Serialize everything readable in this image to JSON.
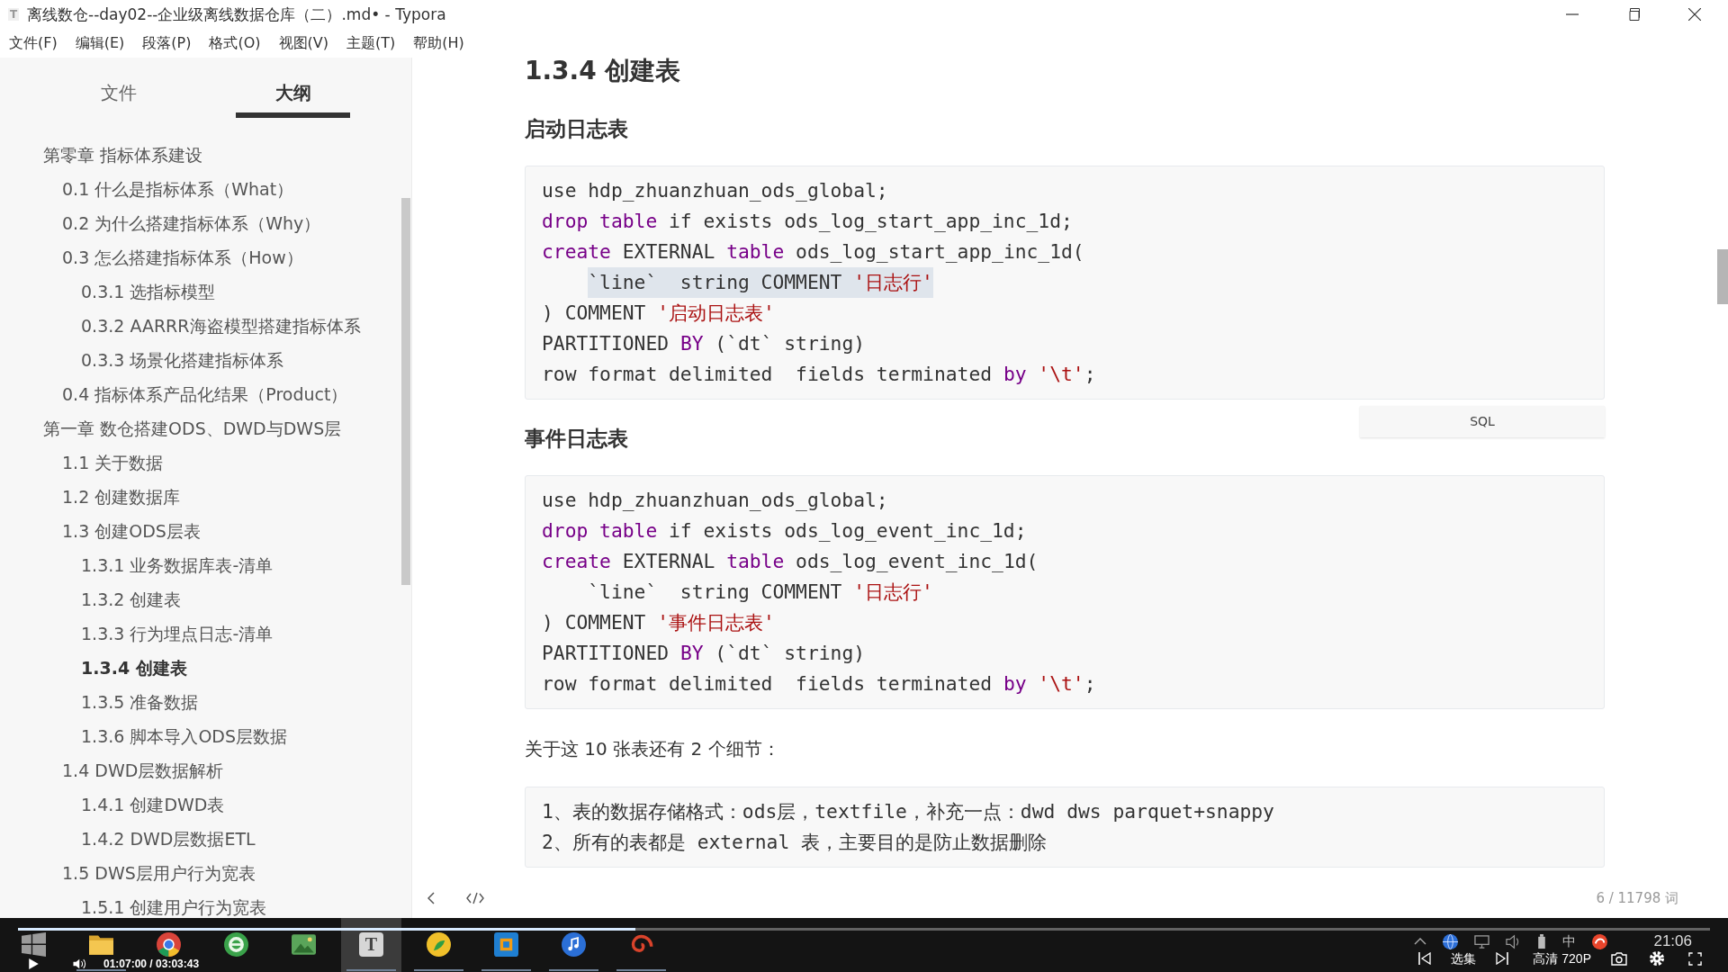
{
  "window": {
    "icon_letter": "T",
    "title": "离线数仓--day02--企业级离线数据仓库（二）.md• - Typora",
    "maximized": true
  },
  "menu": [
    "文件(F)",
    "编辑(E)",
    "段落(P)",
    "格式(O)",
    "视图(V)",
    "主题(T)",
    "帮助(H)"
  ],
  "sidebar": {
    "tabs": [
      {
        "label": "文件",
        "selected": false
      },
      {
        "label": "大纲",
        "selected": true
      }
    ],
    "outline": [
      {
        "label": "第零章 指标体系建设",
        "selected": false,
        "children": [
          {
            "label": "0.1 什么是指标体系（What）",
            "selected": false
          },
          {
            "label": "0.2 为什么搭建指标体系（Why）",
            "selected": false
          },
          {
            "label": "0.3 怎么搭建指标体系（How）",
            "selected": false,
            "children": [
              {
                "label": "0.3.1 选指标模型",
                "selected": false
              },
              {
                "label": "0.3.2 AARRR海盗模型搭建指标体系",
                "selected": false
              },
              {
                "label": "0.3.3 场景化搭建指标体系",
                "selected": false
              }
            ]
          },
          {
            "label": "0.4 指标体系产品化结果（Product）",
            "selected": false
          }
        ]
      },
      {
        "label": "第一章 数仓搭建ODS、DWD与DWS层",
        "selected": false,
        "children": [
          {
            "label": "1.1 关于数据",
            "selected": false
          },
          {
            "label": "1.2 创建数据库",
            "selected": false
          },
          {
            "label": "1.3 创建ODS层表",
            "selected": false,
            "children": [
              {
                "label": "1.3.1 业务数据库表-清单",
                "selected": false
              },
              {
                "label": "1.3.2 创建表",
                "selected": false
              },
              {
                "label": "1.3.3 行为埋点日志-清单",
                "selected": false
              },
              {
                "label": "1.3.4 创建表",
                "selected": true
              },
              {
                "label": "1.3.5 准备数据",
                "selected": false
              },
              {
                "label": "1.3.6 脚本导入ODS层数据",
                "selected": false
              }
            ]
          },
          {
            "label": "1.4 DWD层数据解析",
            "selected": false,
            "children": [
              {
                "label": "1.4.1 创建DWD表",
                "selected": false
              },
              {
                "label": "1.4.2 DWD层数据ETL",
                "selected": false
              }
            ]
          },
          {
            "label": "1.5 DWS层用户行为宽表",
            "selected": false,
            "children": [
              {
                "label": "1.5.1 创建用户行为宽表",
                "selected": false
              }
            ]
          }
        ]
      }
    ]
  },
  "editor": {
    "heading": "1.3.4 创建表",
    "blocks": [
      {
        "kind": "subheading",
        "text": "启动日志表"
      },
      {
        "kind": "code",
        "language": "SQL",
        "lines": [
          {
            "indented": false,
            "highlighted": false,
            "tokens": [
              {
                "kind": "plain",
                "text": "use hdp_zhuanzhuan_ods_global;"
              }
            ]
          },
          {
            "indented": false,
            "highlighted": false,
            "tokens": [
              {
                "kind": "keyword",
                "text": "drop table"
              },
              {
                "kind": "plain",
                "text": " if exists ods_log_start_app_inc_1d;"
              }
            ]
          },
          {
            "indented": false,
            "highlighted": false,
            "tokens": [
              {
                "kind": "keyword",
                "text": "create"
              },
              {
                "kind": "plain",
                "text": " EXTERNAL "
              },
              {
                "kind": "keyword",
                "text": "table"
              },
              {
                "kind": "plain",
                "text": " ods_log_start_app_inc_1d("
              }
            ]
          },
          {
            "indented": true,
            "highlighted": true,
            "tokens": [
              {
                "kind": "plain",
                "text": "`line`  string COMMENT "
              },
              {
                "kind": "string",
                "text": "'日志行'"
              }
            ]
          },
          {
            "indented": false,
            "highlighted": false,
            "tokens": [
              {
                "kind": "plain",
                "text": ") COMMENT "
              },
              {
                "kind": "string",
                "text": "'启动日志表'"
              }
            ]
          },
          {
            "indented": false,
            "highlighted": false,
            "tokens": [
              {
                "kind": "plain",
                "text": "PARTITIONED "
              },
              {
                "kind": "keyword",
                "text": "BY"
              },
              {
                "kind": "plain",
                "text": " (`dt` string)"
              }
            ]
          },
          {
            "indented": false,
            "highlighted": false,
            "tokens": [
              {
                "kind": "plain",
                "text": "row format delimited  fields terminated "
              },
              {
                "kind": "keyword",
                "text": "by"
              },
              {
                "kind": "string",
                "text": " '\\t'"
              },
              {
                "kind": "plain",
                "text": ";"
              }
            ]
          }
        ]
      },
      {
        "kind": "subheading",
        "text": "事件日志表"
      },
      {
        "kind": "code",
        "lines": [
          {
            "indented": false,
            "highlighted": false,
            "tokens": [
              {
                "kind": "plain",
                "text": "use hdp_zhuanzhuan_ods_global;"
              }
            ]
          },
          {
            "indented": false,
            "highlighted": false,
            "tokens": [
              {
                "kind": "keyword",
                "text": "drop table"
              },
              {
                "kind": "plain",
                "text": " if exists ods_log_event_inc_1d;"
              }
            ]
          },
          {
            "indented": false,
            "highlighted": false,
            "tokens": [
              {
                "kind": "keyword",
                "text": "create"
              },
              {
                "kind": "plain",
                "text": " EXTERNAL "
              },
              {
                "kind": "keyword",
                "text": "table"
              },
              {
                "kind": "plain",
                "text": " ods_log_event_inc_1d("
              }
            ]
          },
          {
            "indented": true,
            "highlighted": false,
            "tokens": [
              {
                "kind": "plain",
                "text": "`line`  string COMMENT "
              },
              {
                "kind": "string",
                "text": "'日志行'"
              }
            ]
          },
          {
            "indented": false,
            "highlighted": false,
            "tokens": [
              {
                "kind": "plain",
                "text": ") COMMENT "
              },
              {
                "kind": "string",
                "text": "'事件日志表'"
              }
            ]
          },
          {
            "indented": false,
            "highlighted": false,
            "tokens": [
              {
                "kind": "plain",
                "text": "PARTITIONED "
              },
              {
                "kind": "keyword",
                "text": "BY"
              },
              {
                "kind": "plain",
                "text": " (`dt` string)"
              }
            ]
          },
          {
            "indented": false,
            "highlighted": false,
            "tokens": [
              {
                "kind": "plain",
                "text": "row format delimited  fields terminated "
              },
              {
                "kind": "keyword",
                "text": "by"
              },
              {
                "kind": "string",
                "text": " '\\t'"
              },
              {
                "kind": "plain",
                "text": ";"
              }
            ]
          }
        ]
      },
      {
        "kind": "paragraph",
        "text": "关于这 10 张表还有 2 个细节："
      },
      {
        "kind": "code",
        "lines": [
          {
            "indented": false,
            "highlighted": false,
            "tokens": [
              {
                "kind": "plain",
                "text": "1、表的数据存储格式：ods层，textfile，补充一点：dwd dws parquet+snappy"
              }
            ]
          },
          {
            "indented": false,
            "highlighted": false,
            "tokens": [
              {
                "kind": "plain",
                "text": "2、所有的表都是 external 表，主要目的是防止数据删除"
              }
            ]
          }
        ]
      }
    ]
  },
  "status_bar": {
    "word_count": "6 / 11798 词"
  },
  "taskbar": {
    "apps": [
      {
        "kind": "start",
        "selected": false,
        "running": false
      },
      {
        "kind": "folder",
        "selected": false,
        "running": true
      },
      {
        "kind": "ball",
        "selected": false,
        "running": false
      },
      {
        "kind": "globe",
        "selected": false,
        "running": false
      },
      {
        "kind": "picture",
        "selected": false,
        "running": false
      },
      {
        "kind": "letter",
        "letter": "T",
        "selected": true,
        "running": true
      },
      {
        "kind": "round",
        "selected": false,
        "running": true
      },
      {
        "kind": "square",
        "selected": false,
        "running": true
      },
      {
        "kind": "note",
        "selected": false,
        "running": true
      },
      {
        "kind": "spiral",
        "selected": false,
        "running": true
      }
    ],
    "tray": {
      "input_method": "中",
      "clock": "21:06"
    }
  },
  "video_player": {
    "playing": false,
    "progress": {
      "level": 0.365
    },
    "time": "01:07:00 / 03:03:43",
    "episodes_button": "选集",
    "quality_button": "高清 720P"
  }
}
